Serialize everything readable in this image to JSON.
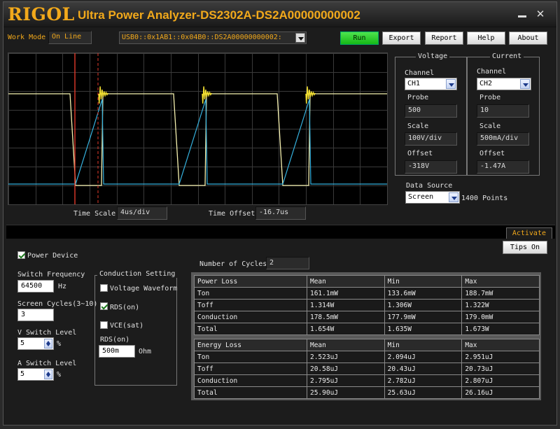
{
  "titlebar": {
    "brand": "RIGOL",
    "title": "Ultra Power Analyzer-DS2302A-DS2A00000000002",
    "minimize_label": "",
    "close_label": "✕"
  },
  "toolbar": {
    "work_mode_label": "Work Mode",
    "work_mode_value": "On Line",
    "resource_prefix": "USB",
    "resource_value": "USB0::0x1AB1::0x04B0::DS2A00000000002:",
    "run_label": "Run",
    "export_label": "Export",
    "report_label": "Report",
    "help_label": "Help",
    "about_label": "About"
  },
  "timebase": {
    "time_scale_label": "Time Scale",
    "time_scale_value": "4us/div",
    "time_offset_label": "Time Offset",
    "time_offset_value": "-16.7us"
  },
  "voltage": {
    "group_title": "Voltage",
    "channel_label": "Channel",
    "channel_value": "CH1",
    "probe_label": "Probe",
    "probe_value": "500",
    "scale_label": "Scale",
    "scale_value": "100V/div",
    "offset_label": "Offset",
    "offset_value": "-318V"
  },
  "current": {
    "group_title": "Current",
    "channel_label": "Channel",
    "channel_value": "CH2",
    "probe_label": "Probe",
    "probe_value": "10",
    "scale_label": "Scale",
    "scale_value": "500mA/div",
    "offset_label": "Offset",
    "offset_value": "-1.47A"
  },
  "data_source": {
    "label": "Data Source",
    "value": "Screen",
    "points_label": "1400 Points"
  },
  "activate_tab": "Activate",
  "tips_button": "Tips On",
  "settings": {
    "power_device_label": "Power Device",
    "power_device_checked": true,
    "switch_frequency_label": "Switch Frequency",
    "switch_frequency_value": "64500",
    "switch_frequency_unit": "Hz",
    "screen_cycles_label": "Screen Cycles(3~10)",
    "screen_cycles_value": "3",
    "v_switch_label": "V Switch Level",
    "v_switch_value": "5",
    "v_switch_unit": "%",
    "a_switch_label": "A Switch Level",
    "a_switch_value": "5",
    "a_switch_unit": "%"
  },
  "conduction": {
    "group_title": "Conduction Setting",
    "voltage_waveform_label": "Voltage Waveform",
    "voltage_waveform_checked": false,
    "rds_on_label": "RDS(on)",
    "rds_on_checked": true,
    "vce_sat_label": "VCE(sat)",
    "vce_sat_checked": false,
    "rds_field_label": "RDS(on)",
    "rds_field_value": "500m",
    "rds_field_unit": "Ohm"
  },
  "cycles": {
    "label": "Number of Cycles:",
    "value": "2"
  },
  "power_loss": {
    "headers": [
      "Power Loss",
      "Mean",
      "Min",
      "Max"
    ],
    "rows": [
      [
        "Ton",
        "161.1mW",
        "133.6mW",
        "188.7mW"
      ],
      [
        "Toff",
        "1.314W",
        "1.306W",
        "1.322W"
      ],
      [
        "Conduction",
        "178.5mW",
        "177.9mW",
        "179.0mW"
      ],
      [
        "Total",
        "1.654W",
        "1.635W",
        "1.673W"
      ]
    ]
  },
  "energy_loss": {
    "headers": [
      "Energy Loss",
      "Mean",
      "Min",
      "Max"
    ],
    "rows": [
      [
        "Ton",
        "2.523uJ",
        "2.094uJ",
        "2.951uJ"
      ],
      [
        "Toff",
        "20.58uJ",
        "20.43uJ",
        "20.73uJ"
      ],
      [
        "Conduction",
        "2.795uJ",
        "2.782uJ",
        "2.807uJ"
      ],
      [
        "Total",
        "25.90uJ",
        "25.63uJ",
        "26.16uJ"
      ]
    ]
  },
  "colors": {
    "brand": "#f2a91b",
    "voltage_trace": "#f7f2b0",
    "current_trace": "#36b3e0",
    "cursor": "#e03a2a",
    "run_button": "#22c422"
  }
}
